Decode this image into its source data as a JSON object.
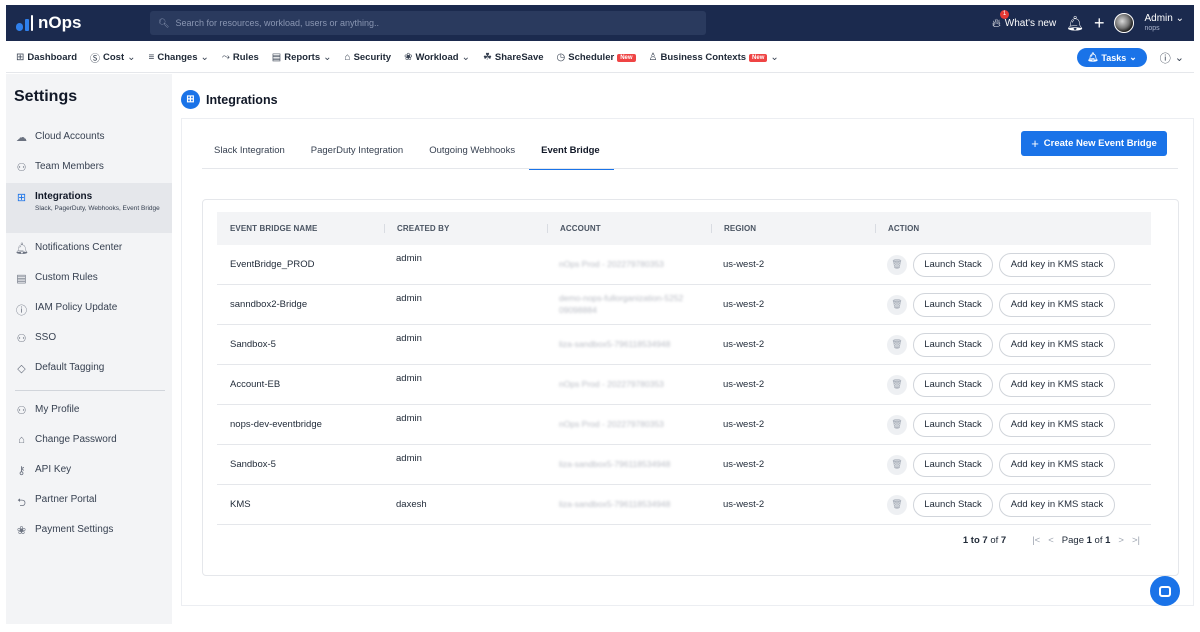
{
  "app": {
    "name": "nOps"
  },
  "search": {
    "placeholder": "Search for resources, workload, users or anything.."
  },
  "topbar": {
    "whats_new": "What's new",
    "notif_count": "1",
    "user_name": "Admin",
    "user_org": "nops"
  },
  "nav": {
    "items": [
      {
        "label": "Dashboard",
        "icon": "grid-icon"
      },
      {
        "label": "Cost",
        "icon": "dollar-icon",
        "dropdown": true
      },
      {
        "label": "Changes",
        "icon": "list-icon",
        "dropdown": true
      },
      {
        "label": "Rules",
        "icon": "rules-icon"
      },
      {
        "label": "Reports",
        "icon": "report-icon",
        "dropdown": true
      },
      {
        "label": "Security",
        "icon": "lock-icon"
      },
      {
        "label": "Workload",
        "icon": "workload-icon",
        "dropdown": true
      },
      {
        "label": "ShareSave",
        "icon": "sharesave-icon"
      },
      {
        "label": "Scheduler",
        "icon": "scheduler-icon",
        "badge": "New"
      },
      {
        "label": "Business Contexts",
        "icon": "business-icon",
        "badge": "New",
        "dropdown": true
      }
    ],
    "tasks_label": "Tasks"
  },
  "sidebar": {
    "title": "Settings",
    "items": [
      {
        "label": "Cloud Accounts",
        "icon": "cloud-icon"
      },
      {
        "label": "Team Members",
        "icon": "team-icon"
      },
      {
        "label": "Integrations",
        "icon": "integrations-icon",
        "sub": "Slack, PagerDuty, Webhooks, Event Bridge",
        "active": true
      },
      {
        "label": "Notifications Center",
        "icon": "bell-icon"
      },
      {
        "label": "Custom Rules",
        "icon": "rules-icon"
      },
      {
        "label": "IAM Policy Update",
        "icon": "info-icon"
      },
      {
        "label": "SSO",
        "icon": "sso-icon"
      },
      {
        "label": "Default Tagging",
        "icon": "tag-icon"
      },
      {
        "label": "My Profile",
        "icon": "user-icon"
      },
      {
        "label": "Change Password",
        "icon": "lock-icon"
      },
      {
        "label": "API Key",
        "icon": "key-icon"
      },
      {
        "label": "Partner Portal",
        "icon": "partner-icon"
      },
      {
        "label": "Payment Settings",
        "icon": "payment-icon"
      }
    ]
  },
  "main": {
    "title": "Integrations",
    "tabs": [
      {
        "label": "Slack Integration"
      },
      {
        "label": "PagerDuty Integration"
      },
      {
        "label": "Outgoing Webhooks"
      },
      {
        "label": "Event Bridge",
        "active": true
      }
    ],
    "create_button": "Create New Event Bridge",
    "table": {
      "headers": [
        "EVENT BRIDGE NAME",
        "CREATED BY",
        "ACCOUNT",
        "REGION",
        "ACTION"
      ],
      "rows": [
        {
          "name": "EventBridge_PROD",
          "created_by": "admin",
          "account": "nOps Prod - 202279780353",
          "region": "us-west-2"
        },
        {
          "name": "sanndbox2-Bridge",
          "created_by": "admin",
          "account": "demo-nops-fullorganization-5252 09098884",
          "region": "us-west-2"
        },
        {
          "name": "Sandbox-5",
          "created_by": "admin",
          "account": "liza-sandbox5-796118534948",
          "region": "us-west-2"
        },
        {
          "name": "Account-EB",
          "created_by": "admin",
          "account": "nOps Prod - 202279780353",
          "region": "us-west-2"
        },
        {
          "name": "nops-dev-eventbridge",
          "created_by": "admin",
          "account": "nOps Prod - 202279780353",
          "region": "us-west-2"
        },
        {
          "name": "Sandbox-5",
          "created_by": "admin",
          "account": "liza-sandbox5-796118534948",
          "region": "us-west-2"
        },
        {
          "name": "KMS",
          "created_by": "daxesh",
          "account": "liza-sandbox5-796118534948",
          "region": "us-west-2"
        }
      ],
      "launch_label": "Launch Stack",
      "kms_label": "Add key in KMS stack"
    },
    "pager": {
      "range_start": "1",
      "range_end": "7",
      "total": "7",
      "page": "1",
      "pages": "1"
    }
  }
}
